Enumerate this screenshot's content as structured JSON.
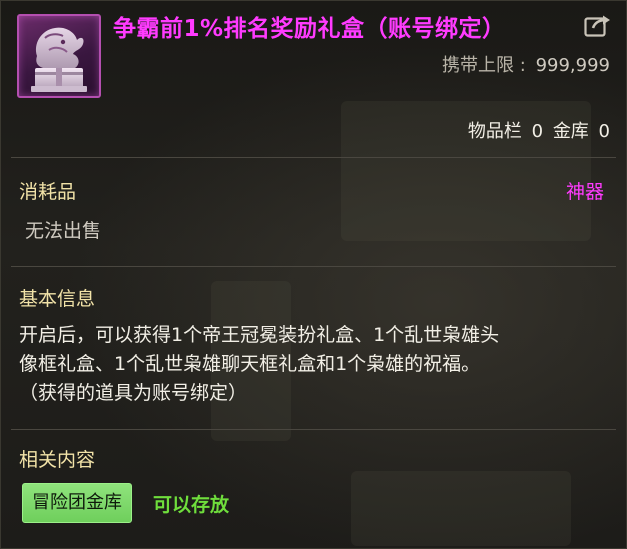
{
  "item": {
    "title": "争霸前1%排名奖励礼盒（账号绑定）",
    "carry_limit_label": "携带上限 :",
    "carry_limit_value": "999,999",
    "inventory_label": "物品栏",
    "inventory_count": "0",
    "vault_label": "金库",
    "vault_count": "0",
    "type": "消耗品",
    "grade": "神器",
    "sell_status": "无法出售"
  },
  "basic_info": {
    "title": "基本信息",
    "lines": [
      "开启后，可以获得1个帝王冠冕装扮礼盒、1个乱世枭雄头",
      "像框礼盒、1个乱世枭雄聊天框礼盒和1个枭雄的祝福。",
      "（获得的道具为账号绑定）"
    ]
  },
  "related": {
    "title": "相关内容",
    "button_label": "冒险团金库",
    "status_label": "可以存放"
  },
  "icons": {
    "item_icon": "dragon-gift-box-icon",
    "share_icon": "share-icon"
  },
  "colors": {
    "title": "#ff3bff",
    "grade": "#ff3bff",
    "section_title": "#f2e3a8",
    "button_bg": "#7ad967",
    "storable": "#6fde3c"
  }
}
